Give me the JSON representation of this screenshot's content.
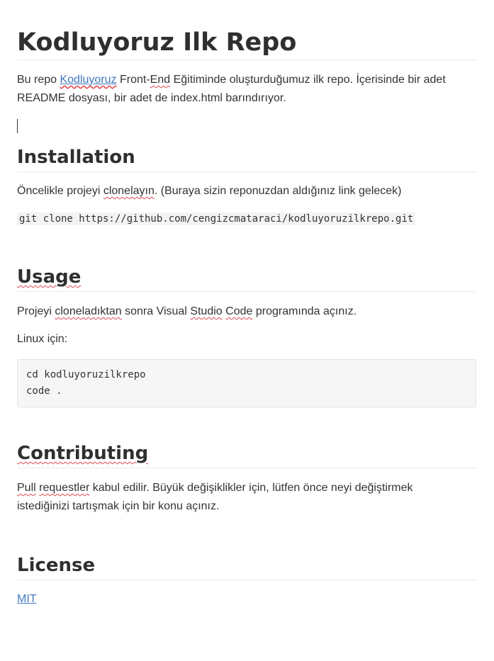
{
  "title": "Kodluyoruz Ilk Repo",
  "intro": {
    "prefix": "Bu repo ",
    "link": "Kodluyoruz",
    "mid1": " Front-",
    "squiggle_end": "End",
    "rest1": " Eğitiminde oluşturduğumuz ilk repo. İçerisinde bir adet",
    "rest2": "README dosyası, bir adet de index.html barındırıyor."
  },
  "installation": {
    "heading": "Installation",
    "text_a": "Öncelikle projeyi ",
    "text_b": "clonelayın",
    "text_c": ". (Buraya sizin reponuzdan aldığınız link gelecek)",
    "code": "git clone https://github.com/cengizcmataraci/kodluyoruzilkrepo.git"
  },
  "usage": {
    "heading": "Usage",
    "text_a": "Projeyi ",
    "text_b": "cloneladıktan",
    "text_c": " sonra Visual ",
    "text_d": "Studio",
    "text_e": " ",
    "text_f": "Code",
    "text_g": " programında açınız.",
    "linux": "Linux için:",
    "code": "cd kodluyoruzilkrepo\ncode ."
  },
  "contributing": {
    "heading": "Contributing",
    "pull": "Pull",
    "requestler": "requestler",
    "line1": " kabul edilir. Büyük değişiklikler için, lütfen önce neyi değiştirmek",
    "line2": "istediğinizi tartışmak için bir konu açınız."
  },
  "license": {
    "heading": "License",
    "link": "MIT"
  },
  "colors": {
    "link": "#4078c0",
    "spellcheck_underline": "#e5484d",
    "code_block_bg": "#f6f6f6"
  }
}
